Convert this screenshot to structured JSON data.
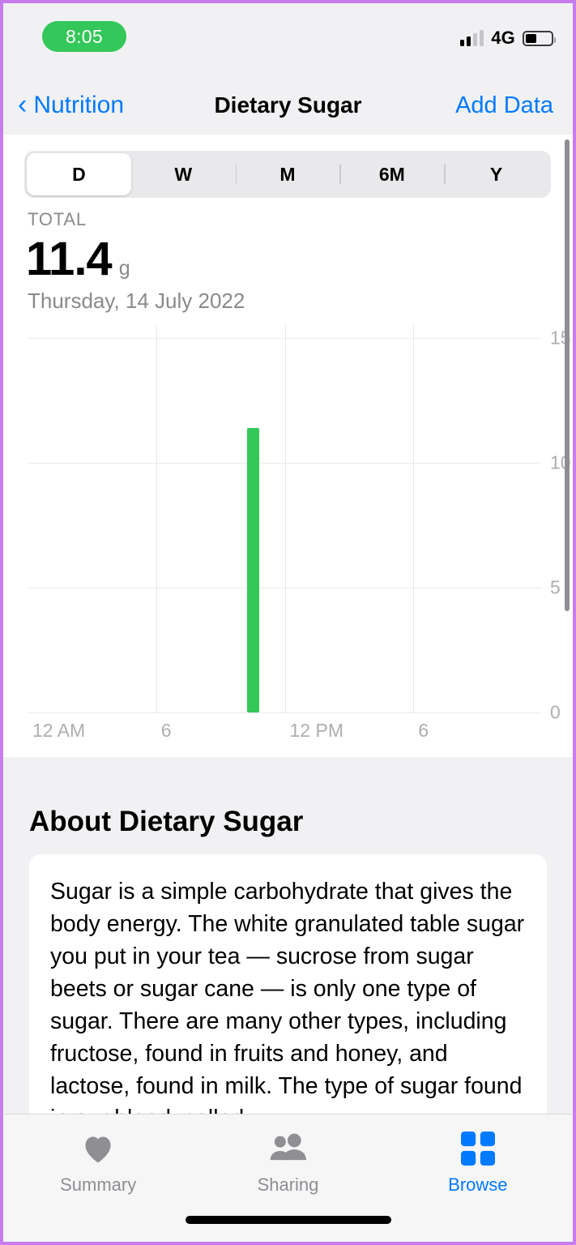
{
  "status_bar": {
    "time": "8:05",
    "time_pill_color": "#34c759",
    "network": "4G",
    "signal_bars_filled": 2,
    "signal_bars_total": 4,
    "battery_percent": 42,
    "icons": [
      "cellular-signal-icon",
      "battery-icon"
    ]
  },
  "nav_bar": {
    "back_label": "Nutrition",
    "back_icon": "chevron-left-icon",
    "title": "Dietary Sugar",
    "action_label": "Add Data",
    "accent_color": "#007aff"
  },
  "segmented_control": {
    "options": [
      "D",
      "W",
      "M",
      "6M",
      "Y"
    ],
    "selected": "D"
  },
  "summary": {
    "label": "TOTAL",
    "value": "11.4",
    "unit": "g",
    "date": "Thursday, 14 July 2022"
  },
  "chart_data": {
    "type": "bar",
    "title": "Dietary Sugar",
    "xlabel": "",
    "ylabel": "g",
    "x_tick_labels": [
      "12 AM",
      "6",
      "12 PM",
      "6"
    ],
    "x_tick_hours": [
      0,
      6,
      12,
      18
    ],
    "y_tick_labels": [
      "15",
      "10",
      "5",
      "0"
    ],
    "y_ticks": [
      15,
      10,
      5,
      0
    ],
    "ylim": [
      0,
      15.5
    ],
    "xlim": [
      0,
      24
    ],
    "grid": true,
    "legend": false,
    "bar_color": "#34c759",
    "categories": [
      "10:30"
    ],
    "values": [
      11.4
    ],
    "series": [
      {
        "name": "Dietary Sugar",
        "x": [
          10.5
        ],
        "values": [
          11.4
        ]
      }
    ]
  },
  "about": {
    "title": "About Dietary Sugar",
    "body": "Sugar is a simple carbohydrate that gives the body energy. The white granulated table sugar you put in your tea — sucrose from sugar beets or sugar cane — is only one type of sugar. There are many other types, including fructose, found in fruits and honey, and lactose, found in milk. The type of sugar found in our blood, called"
  },
  "tab_bar": {
    "tabs": [
      {
        "label": "Summary",
        "icon": "heart-icon",
        "active": false
      },
      {
        "label": "Sharing",
        "icon": "people-icon",
        "active": false
      },
      {
        "label": "Browse",
        "icon": "grid-icon",
        "active": true
      }
    ],
    "active_color": "#007aff",
    "inactive_color": "#8e8e93"
  }
}
